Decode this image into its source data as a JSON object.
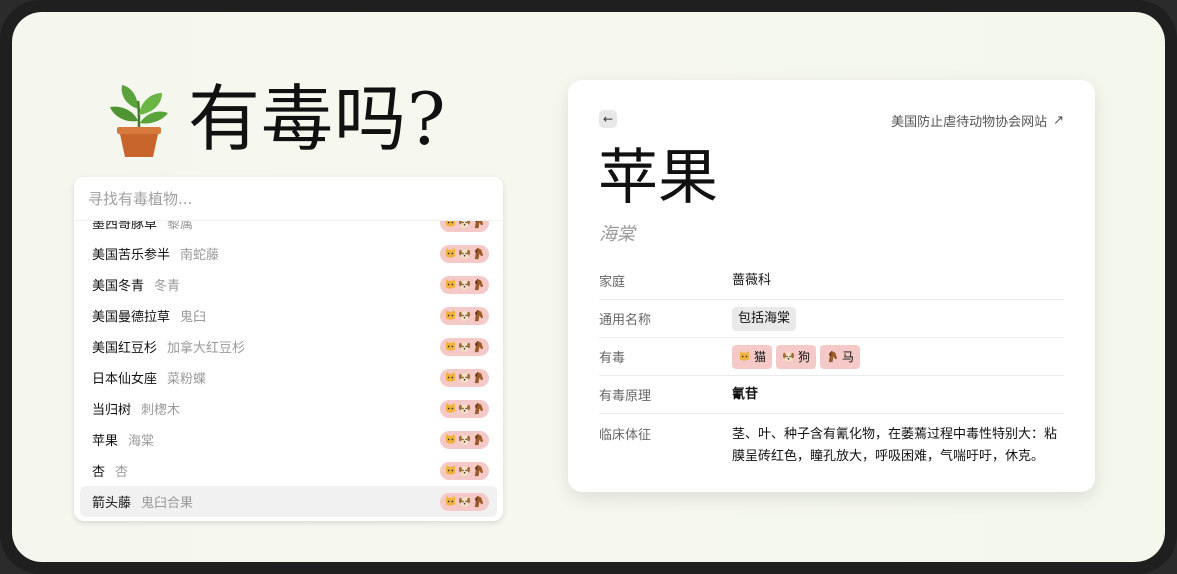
{
  "brand": {
    "title": "有毒吗?",
    "logo_icon": "potted-plant-icon"
  },
  "search": {
    "placeholder": "寻找有毒植物..."
  },
  "list": {
    "items": [
      {
        "name": "墨西哥豚草",
        "latin": "藜属",
        "toxic_to": [
          "cat",
          "dog",
          "horse"
        ]
      },
      {
        "name": "美国苦乐参半",
        "latin": "南蛇藤",
        "toxic_to": [
          "cat",
          "dog",
          "horse"
        ]
      },
      {
        "name": "美国冬青",
        "latin": "冬青",
        "toxic_to": [
          "cat",
          "dog",
          "horse"
        ]
      },
      {
        "name": "美国曼德拉草",
        "latin": "鬼臼",
        "toxic_to": [
          "cat",
          "dog",
          "horse"
        ]
      },
      {
        "name": "美国红豆杉",
        "latin": "加拿大红豆杉",
        "toxic_to": [
          "cat",
          "dog",
          "horse"
        ]
      },
      {
        "name": "日本仙女座",
        "latin": "菜粉蝶",
        "toxic_to": [
          "cat",
          "dog",
          "horse"
        ]
      },
      {
        "name": "当归树",
        "latin": "刺楤木",
        "toxic_to": [
          "cat",
          "dog",
          "horse"
        ]
      },
      {
        "name": "苹果",
        "latin": "海棠",
        "toxic_to": [
          "cat",
          "dog",
          "horse"
        ]
      },
      {
        "name": "杏",
        "latin": "杏",
        "toxic_to": [
          "cat",
          "dog",
          "horse"
        ]
      },
      {
        "name": "箭头藤",
        "latin": "鬼臼合果",
        "toxic_to": [
          "cat",
          "dog",
          "horse"
        ],
        "selected": true
      }
    ]
  },
  "detail": {
    "back_icon": "arrow-left-icon",
    "external_link": "美国防止虐待动物协会网站",
    "external_link_icon": "arrow-up-right-icon",
    "title": "苹果",
    "latin": "海棠",
    "rows": {
      "family": {
        "label": "家庭",
        "value": "蔷薇科"
      },
      "common": {
        "label": "通用名称",
        "value": "包括海棠"
      },
      "toxic": {
        "label": "有毒",
        "animals": [
          {
            "key": "cat",
            "label": "猫",
            "icon": "cat-face-icon"
          },
          {
            "key": "dog",
            "label": "狗",
            "icon": "dog-face-icon"
          },
          {
            "key": "horse",
            "label": "马",
            "icon": "horse-icon"
          }
        ]
      },
      "principle": {
        "label": "有毒原理",
        "value": "氰苷"
      },
      "signs": {
        "label": "临床体征",
        "value": "茎、叶、种子含有氰化物，在萎蔫过程中毒性特别大：粘膜呈砖红色，瞳孔放大，呼吸困难，气喘吁吁，休克。"
      }
    }
  },
  "colors": {
    "toxic_badge_bg": "#f6c9c9",
    "chip_bg": "#e9e9e9",
    "background": "#f5f7ee"
  }
}
